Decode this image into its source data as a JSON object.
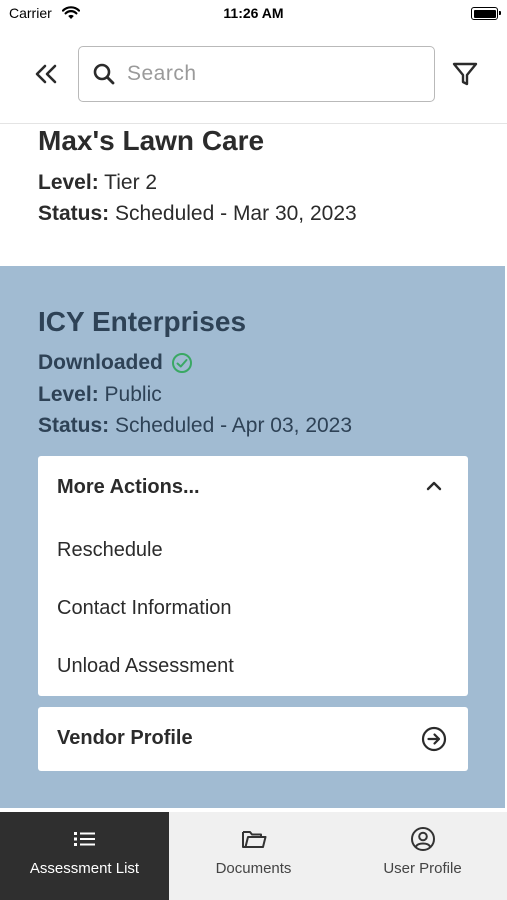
{
  "status_bar": {
    "carrier": "Carrier",
    "time": "11:26 AM"
  },
  "search": {
    "placeholder": "Search",
    "value": ""
  },
  "cards": [
    {
      "name": "Max's Lawn Care",
      "level_label": "Level:",
      "level": "Tier 2",
      "status_label": "Status:",
      "status": "Scheduled - Mar 30, 2023"
    },
    {
      "name": "ICY Enterprises",
      "badge": "Downloaded",
      "level_label": "Level:",
      "level": "Public",
      "status_label": "Status:",
      "status": "Scheduled - Apr 03, 2023",
      "more_actions": {
        "title": "More Actions...",
        "items": [
          "Reschedule",
          "Contact Information",
          "Unload Assessment"
        ]
      },
      "vendor_profile": "Vendor Profile"
    }
  ],
  "tabs": [
    {
      "label": "Assessment List",
      "icon": "list-icon",
      "active": true
    },
    {
      "label": "Documents",
      "icon": "folder-icon",
      "active": false
    },
    {
      "label": "User Profile",
      "icon": "user-circle-icon",
      "active": false
    }
  ],
  "colors": {
    "selected_card_bg": "#a1bbd2",
    "selected_card_text": "#2e4256",
    "downloaded_check": "#3aa864",
    "active_tab_bg": "#2f2f2f",
    "tab_bar_bg": "#f0f0f0"
  }
}
